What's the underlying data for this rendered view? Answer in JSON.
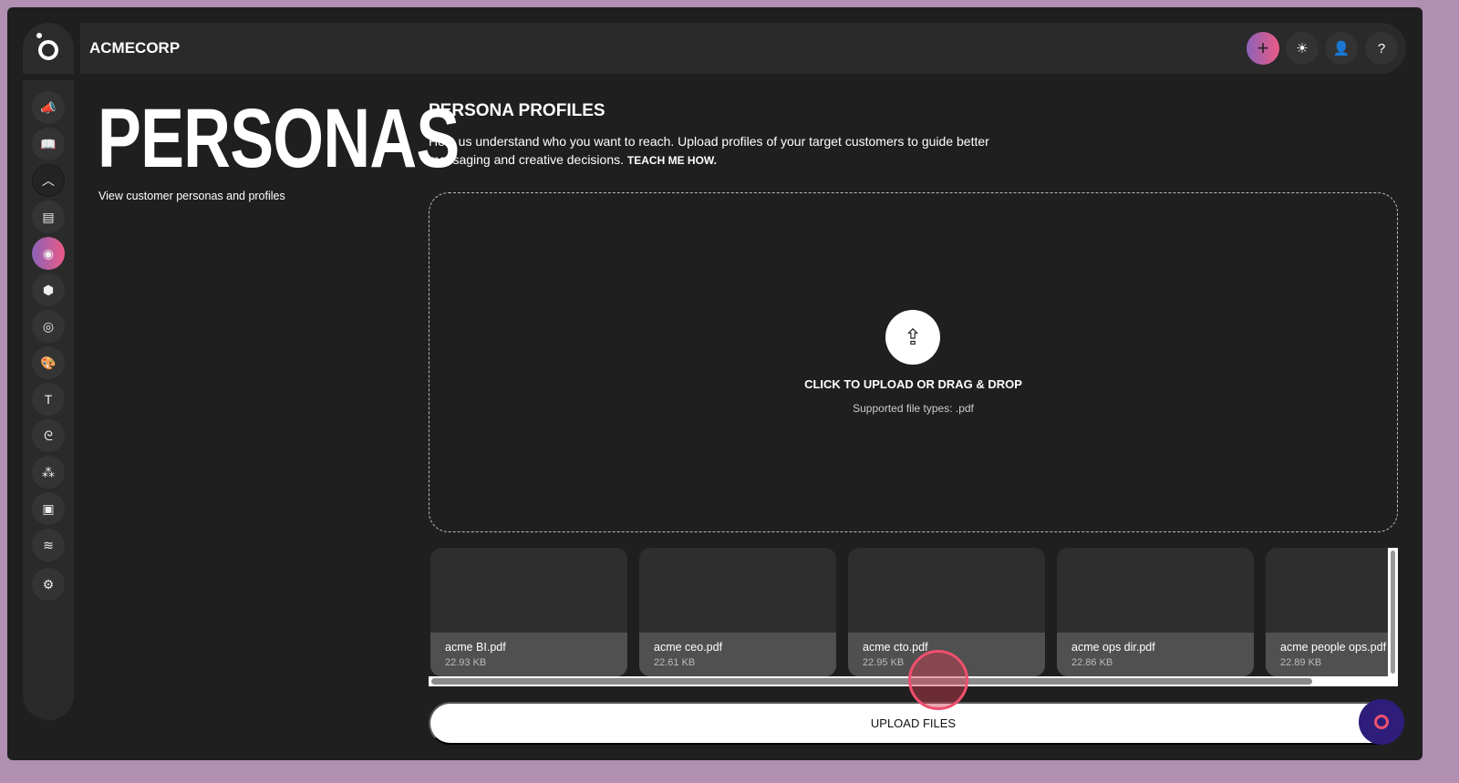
{
  "header": {
    "brand": "ACMECORP",
    "buttons": [
      {
        "name": "add",
        "icon": "plus-icon",
        "glyph": "+"
      },
      {
        "name": "theme",
        "icon": "sun-icon",
        "glyph": "☀"
      },
      {
        "name": "profile",
        "icon": "user-icon",
        "glyph": "👤"
      },
      {
        "name": "help",
        "icon": "help-icon",
        "glyph": "?"
      }
    ]
  },
  "sidebar": {
    "items": [
      {
        "icon": "megaphone-icon",
        "glyph": "📣"
      },
      {
        "icon": "book-icon",
        "glyph": "📖"
      },
      {
        "icon": "chevron-up-icon",
        "glyph": "︿"
      },
      {
        "icon": "document-icon",
        "glyph": "▤"
      },
      {
        "icon": "persona-icon",
        "glyph": "◉",
        "active": true
      },
      {
        "icon": "cube-icon",
        "glyph": "⬢"
      },
      {
        "icon": "target-icon",
        "glyph": "◎"
      },
      {
        "icon": "palette-icon",
        "glyph": "🎨"
      },
      {
        "icon": "text-icon",
        "glyph": "T"
      },
      {
        "icon": "signature-icon",
        "glyph": "ᘓ"
      },
      {
        "icon": "circles-icon",
        "glyph": "⁂"
      },
      {
        "icon": "image-icon",
        "glyph": "▣"
      },
      {
        "icon": "layers-icon",
        "glyph": "≋"
      },
      {
        "icon": "settings-icon",
        "glyph": "⚙"
      }
    ]
  },
  "page": {
    "title": "PERSONAS",
    "subtitle": "View customer personas and profiles"
  },
  "section": {
    "title": "PERSONA PROFILES",
    "description": "Help us understand who you want to reach. Upload profiles of your target customers to guide better messaging and creative decisions.",
    "link": "TEACH ME HOW."
  },
  "dropzone": {
    "main": "CLICK TO UPLOAD OR DRAG & DROP",
    "sub": "Supported file types: .pdf"
  },
  "files": [
    {
      "name": "acme BI.pdf",
      "size": "22.93 KB"
    },
    {
      "name": "acme ceo.pdf",
      "size": "22.61 KB"
    },
    {
      "name": "acme cto.pdf",
      "size": "22.95 KB"
    },
    {
      "name": "acme ops dir.pdf",
      "size": "22.86 KB"
    },
    {
      "name": "acme people ops.pdf",
      "size": "22.89 KB"
    }
  ],
  "upload_button": "UPLOAD FILES"
}
